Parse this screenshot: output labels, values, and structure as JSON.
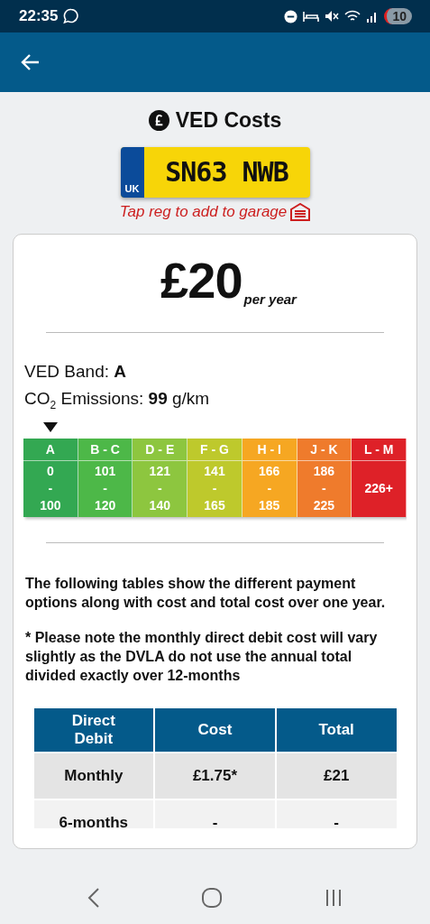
{
  "status_bar": {
    "time": "22:35",
    "notification_count": "10"
  },
  "page": {
    "title": "VED Costs",
    "registration": "SN63 NWB",
    "plate_country": "UK",
    "garage_hint": "Tap reg to add to garage"
  },
  "cost": {
    "amount": "£20",
    "period": "per year"
  },
  "band_info": {
    "band": "VED Band: **A**",
    "emissions": "CO$_{2}$ Emissions: **99** g/km"
  },
  "bands": [
    {
      "label": "A",
      "from": "0",
      "sep": "-",
      "to": "100",
      "color": "#33a852",
      "selected": true
    },
    {
      "label": "B - C",
      "from": "101",
      "sep": "-",
      "to": "120",
      "color": "#4db848",
      "selected": false
    },
    {
      "label": "D - E",
      "from": "121",
      "sep": "-",
      "to": "140",
      "color": "#8dc63f",
      "selected": false
    },
    {
      "label": "F - G",
      "from": "141",
      "sep": "-",
      "to": "165",
      "color": "#bec92c",
      "selected": false
    },
    {
      "label": "H - I",
      "from": "166",
      "sep": "-",
      "to": "185",
      "color": "#f6a722",
      "selected": false
    },
    {
      "label": "J - K",
      "from": "186",
      "sep": "-",
      "to": "225",
      "color": "#ef7b2c",
      "selected": false
    },
    {
      "label": "L - M",
      "single": "226+",
      "color": "#de2128",
      "selected": false
    }
  ],
  "notes": [
    "The following tables show the different payment options along with cost and total cost over one year.",
    "* Please note the monthly direct debit cost will vary slightly as the DVLA do not use the annual total divided exactly over 12-months"
  ],
  "table": {
    "columns": [
      "Direct Debit",
      "Cost",
      "Total"
    ],
    "rows": [
      [
        "Monthly",
        "£1.75*",
        "£21"
      ],
      [
        "6-months",
        "-",
        "-"
      ]
    ]
  }
}
